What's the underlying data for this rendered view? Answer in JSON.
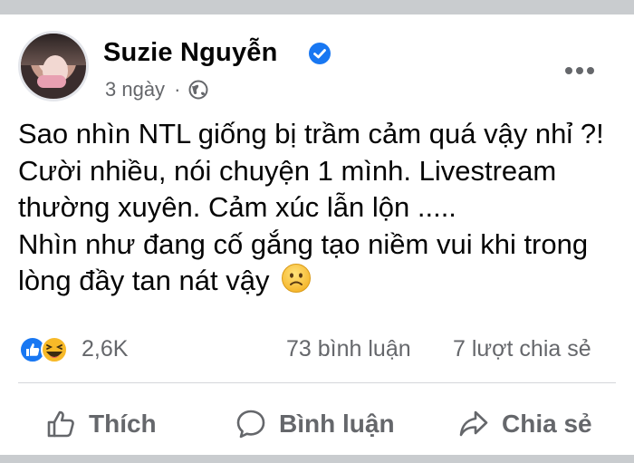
{
  "post": {
    "author": "Suzie Nguyễn",
    "time": "3 ngày",
    "separator": "·",
    "privacy_icon": "globe-icon",
    "verified_icon": "verified-badge-icon",
    "text_lines": [
      "Sao nhìn NTL giống bị trầm cảm quá vậy nhỉ ?!",
      "Cười nhiều, nói chuyện 1 mình. Livestream",
      "thường xuyên. Cảm xúc lẫn lộn .....",
      "Nhìn như đang cố gắng tạo niềm vui khi trong",
      "lòng đầy tan nát vậy"
    ],
    "emoji": "sad-face"
  },
  "stats": {
    "reactions": "2,6K",
    "comments": "73 bình luận",
    "shares": "7 lượt chia sẻ",
    "reaction_icons": [
      "like-icon",
      "haha-icon"
    ]
  },
  "actions": {
    "like": "Thích",
    "comment": "Bình luận",
    "share": "Chia sẻ"
  },
  "colors": {
    "text": "#050505",
    "secondary": "#65676b",
    "brand_blue": "#1877f2",
    "haha_yellow": "#f7b928"
  }
}
